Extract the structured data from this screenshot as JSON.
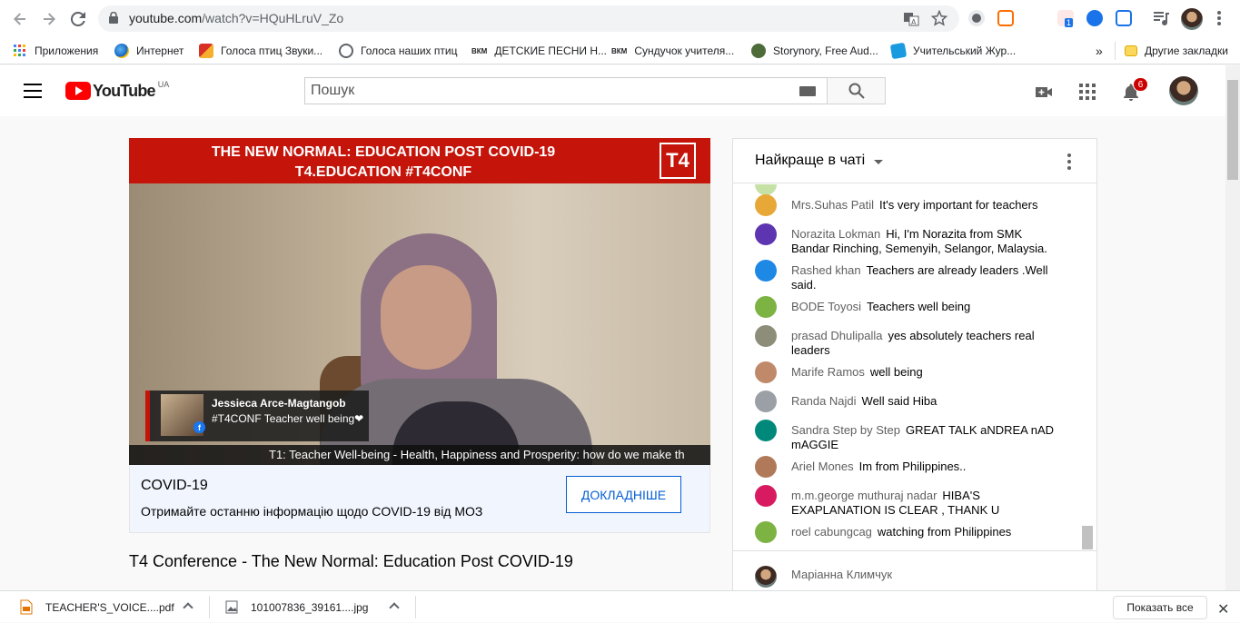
{
  "browser": {
    "url_host": "youtube.com",
    "url_path": "/watch?v=HQuHLruV_Zo",
    "bookmarks": [
      {
        "label": "Приложения",
        "color": "#4285f4"
      },
      {
        "label": "Интернет",
        "color": "#ea8600"
      },
      {
        "label": "Голоса птиц Звуки...",
        "color": "#d93025"
      },
      {
        "label": "Голоса наших птиц",
        "color": "#5f6368"
      },
      {
        "label": "ДЕТСКИЕ ПЕСНИ Н...",
        "color": "#202124"
      },
      {
        "label": "Сундучок учителя...",
        "color": "#202124"
      },
      {
        "label": "Storynory, Free Aud...",
        "color": "#4e6b3a"
      },
      {
        "label": "Учительський Жур...",
        "color": "#1a9be0"
      }
    ],
    "bookmarks_overflow": "»",
    "other_bookmarks": "Другие закладки",
    "ext_badge": "1"
  },
  "youtube": {
    "logo_text": "YouTube",
    "country": "UA",
    "search_placeholder": "Пошук",
    "notifications_count": "6"
  },
  "video": {
    "banner_line1": "THE NEW NORMAL: EDUCATION POST COVID-19",
    "banner_line2": "T4.EDUCATION #T4CONF",
    "logo": "T4",
    "lower_third_name": "Jessieca Arce-Magtangob",
    "lower_third_text": "#T4CONF Teacher well being❤",
    "ticker": "T1: Teacher Well-being - Health, Happiness and Prosperity: how do we make th"
  },
  "covid": {
    "title": "COVID-19",
    "text": "Отримайте останню інформацію щодо COVID-19 від МОЗ",
    "button": "ДОКЛАДНІШЕ"
  },
  "title": "T4 Conference - The New Normal: Education Post COVID-19",
  "chat": {
    "mode": "Найкраще в чаті",
    "messages": [
      {
        "author": "Mrs.Suhas Patil",
        "text": "It's very important for teachers",
        "avatar": "#e8a838"
      },
      {
        "author": "Norazita Lokman",
        "text": "Hi, I'm Norazita from SMK Bandar Rinching, Semenyih, Selangor, Malaysia.",
        "avatar": "#5e35b1"
      },
      {
        "author": "Rashed khan",
        "text": "Teachers are already leaders .Well said.",
        "avatar": "#1e88e5"
      },
      {
        "author": "BODE Toyosi",
        "text": "Teachers well being",
        "avatar": "#7cb342"
      },
      {
        "author": "prasad Dhulipalla",
        "text": "yes absolutely teachers real leaders",
        "avatar": "#8d8d7a"
      },
      {
        "author": "Marife Ramos",
        "text": "well being",
        "avatar": "#c08a6a"
      },
      {
        "author": "Randa Najdi",
        "text": "Well said Hiba",
        "avatar": "#9aa0a6"
      },
      {
        "author": "Sandra Step by Step",
        "text": "GREAT TALK aNDREA nAD mAGGIE",
        "avatar": "#00897b"
      },
      {
        "author": "Ariel Mones",
        "text": "Im from Philippines..",
        "avatar": "#b07a5a"
      },
      {
        "author": "m.m.george muthuraj nadar",
        "text": "HIBA'S EXAPLANATION IS CLEAR , THANK U",
        "avatar": "#d81b60"
      },
      {
        "author": "roel cabungcag",
        "text": "watching from Philippines",
        "avatar": "#7cb342"
      }
    ],
    "current_user": "Маріанна Климчук"
  },
  "downloads": {
    "items": [
      {
        "name": "TEACHER'S_VOICE....pdf",
        "icon": "pdf-file-icon"
      },
      {
        "name": "101007836_39161....jpg",
        "icon": "image-file-icon"
      }
    ],
    "show_all": "Показать все"
  }
}
